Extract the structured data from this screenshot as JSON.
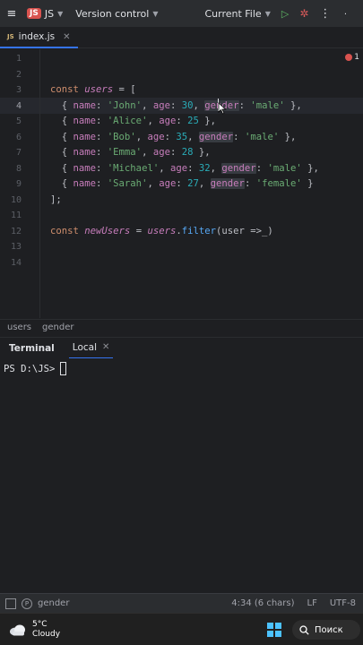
{
  "titlebar": {
    "project_badge": "JS",
    "project_name": "JS",
    "vcs_label": "Version control",
    "run_config": "Current File",
    "right_dot": "."
  },
  "tab": {
    "label": "index.js"
  },
  "editor": {
    "line_numbers": [
      "1",
      "2",
      "3",
      "4",
      "5",
      "6",
      "7",
      "8",
      "9",
      "10",
      "11",
      "12",
      "13",
      "14"
    ],
    "active_line": "4",
    "warnings": "1",
    "lines": {
      "l3": {
        "kw": "const",
        "var": "users",
        "rest": " = ["
      },
      "l4": {
        "open": "  { ",
        "p1": "name",
        "s1": "'John'",
        "p2": "age",
        "n1": "30",
        "p3": "gender",
        "s3": "'male'",
        "close": " },"
      },
      "l5": {
        "open": "  { ",
        "p1": "name",
        "s1": "'Alice'",
        "p2": "age",
        "n1": "25",
        "close": " },"
      },
      "l6": {
        "open": "  { ",
        "p1": "name",
        "s1": "'Bob'",
        "p2": "age",
        "n1": "35",
        "p3": "gender",
        "s3": "'male'",
        "close": " },"
      },
      "l7": {
        "open": "  { ",
        "p1": "name",
        "s1": "'Emma'",
        "p2": "age",
        "n1": "28",
        "close": " },"
      },
      "l8": {
        "open": "  { ",
        "p1": "name",
        "s1": "'Michael'",
        "p2": "age",
        "n1": "32",
        "p3": "gender",
        "s3": "'male'",
        "close": " },"
      },
      "l9": {
        "open": "  { ",
        "p1": "name",
        "s1": "'Sarah'",
        "p2": "age",
        "n1": "27",
        "p3": "gender",
        "s3": "'female'",
        "close": " }"
      },
      "l10": {
        "text": "];"
      },
      "l12": {
        "kw": "const",
        "var": "newUsers",
        "eq": " = ",
        "obj": "users",
        "dot": ".",
        "fn": "filter",
        "args": "(user =>_)"
      }
    }
  },
  "breadcrumbs": {
    "b1": "users",
    "b2": "gender"
  },
  "terminal": {
    "title": "Terminal",
    "tab_label": "Local",
    "prompt": "PS D:\\JS>"
  },
  "statusbar": {
    "context": "gender",
    "position": "4:34 (6 chars)",
    "line_sep": "LF",
    "encoding": "UTF-8"
  },
  "taskbar": {
    "temp": "5°C",
    "condition": "Cloudy",
    "search_label": "Поиск"
  }
}
